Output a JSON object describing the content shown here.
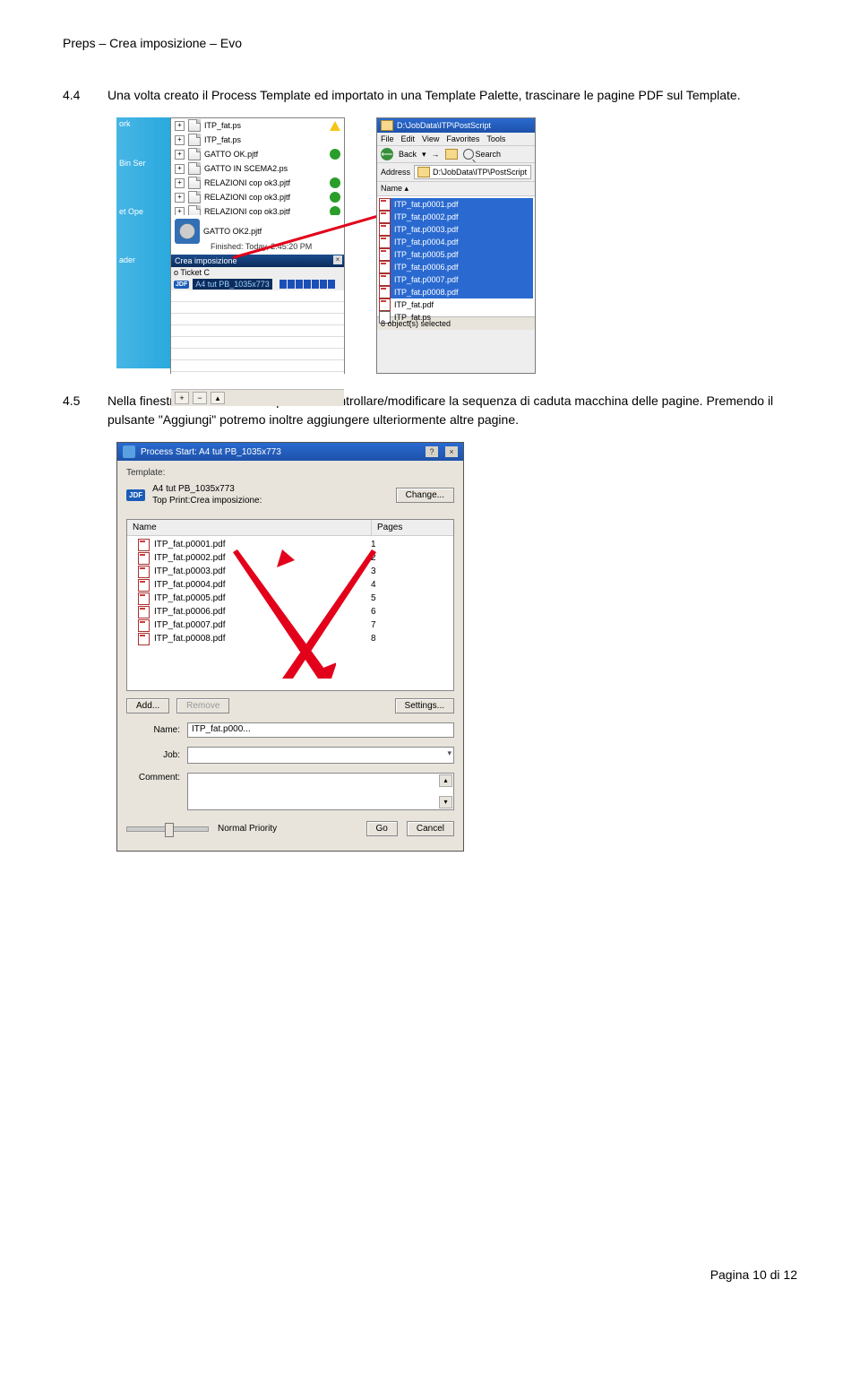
{
  "doc_header": "Preps – Crea imposizione – Evo",
  "para1": {
    "num": "4.4",
    "text": "Una volta creato il Process Template ed importato in una Template Palette, trascinare le pagine PDF sul Template."
  },
  "para2": {
    "num": "4.5",
    "text": "Nella finestra di Process Start potremo controllare/modificare la sequenza di caduta macchina delle pagine. Premendo il pulsante \"Aggiungi\" potremo inoltre aggiungere ulteriormente altre pagine."
  },
  "footer": "Pagina 10 di 12",
  "fig1": {
    "leftStrip": {
      "r1": "ork",
      "r2": "Bin    Ser",
      "r3": "et    Ope",
      "r4": "ader"
    },
    "tree": {
      "items": [
        {
          "name": "ITP_fat.ps",
          "status": "warn"
        },
        {
          "name": "ITP_fat.ps",
          "status": ""
        },
        {
          "name": "GATTO OK.pjtf",
          "status": "ok"
        },
        {
          "name": "GATTO IN SCEMA2.ps",
          "status": ""
        },
        {
          "name": "RELAZIONI cop ok3.pjtf",
          "status": "ok"
        },
        {
          "name": "RELAZIONI cop ok3.pjtf",
          "status": "ok"
        },
        {
          "name": "RELAZIONI cop ok3.pjtf",
          "status": "ok"
        }
      ],
      "gattoJob": "GATTO OK2.pjtf",
      "finished": "Finished: Today, 2:45:20 PM",
      "creaBar": "Crea imposizione",
      "ticketHint": "o Ticket                      C",
      "jobName": "A4 tut PB_1035x773"
    },
    "explorer": {
      "title": "D:\\JobData\\ITP\\PostScript",
      "menu": {
        "file": "File",
        "edit": "Edit",
        "view": "View",
        "fav": "Favorites",
        "tools": "Tools"
      },
      "toolbar": {
        "back": "Back",
        "search": "Search"
      },
      "addressLabel": "Address",
      "addressValue": "D:\\JobData\\ITP\\PostScript",
      "colName": "Name",
      "files": [
        "ITP_fat.p0001.pdf",
        "ITP_fat.p0002.pdf",
        "ITP_fat.p0003.pdf",
        "ITP_fat.p0004.pdf",
        "ITP_fat.p0005.pdf",
        "ITP_fat.p0006.pdf",
        "ITP_fat.p0007.pdf",
        "ITP_fat.p0008.pdf"
      ],
      "extra1": "ITP_fat.pdf",
      "extra2": "ITP_fat.ps",
      "status": "8 object(s) selected"
    }
  },
  "fig2": {
    "title": "Process Start: A4 tut PB_1035x773",
    "templateLabel": "Template:",
    "tmplName": "A4 tut PB_1035x773",
    "tmplSub": "Top Print:Crea imposizione:",
    "changeBtn": "Change...",
    "col1": "Name",
    "col2": "Pages",
    "rows": [
      {
        "name": "ITP_fat.p0001.pdf",
        "pages": "1"
      },
      {
        "name": "ITP_fat.p0002.pdf",
        "pages": "2"
      },
      {
        "name": "ITP_fat.p0003.pdf",
        "pages": "3"
      },
      {
        "name": "ITP_fat.p0004.pdf",
        "pages": "4"
      },
      {
        "name": "ITP_fat.p0005.pdf",
        "pages": "5"
      },
      {
        "name": "ITP_fat.p0006.pdf",
        "pages": "6"
      },
      {
        "name": "ITP_fat.p0007.pdf",
        "pages": "7"
      },
      {
        "name": "ITP_fat.p0008.pdf",
        "pages": "8"
      }
    ],
    "addBtn": "Add...",
    "removeBtn": "Remove",
    "settingsBtn": "Settings...",
    "nameLabel": "Name:",
    "nameValue": "ITP_fat.p000...",
    "jobLabel": "Job:",
    "commentLabel": "Comment:",
    "priority": "Normal Priority",
    "goBtn": "Go",
    "cancelBtn": "Cancel"
  }
}
